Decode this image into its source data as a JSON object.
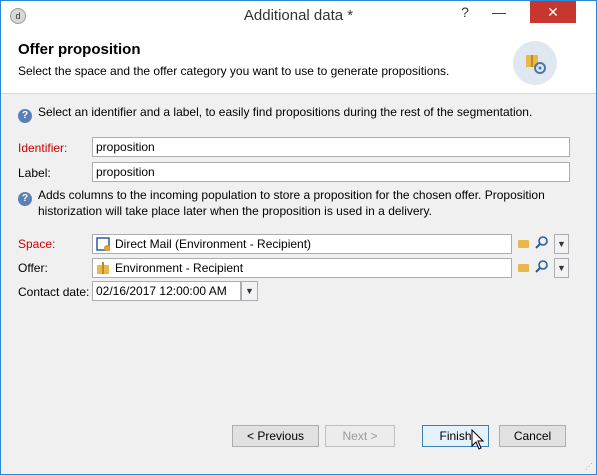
{
  "window": {
    "title": "Additional data *",
    "help_label": "?",
    "minimize_label": "—",
    "close_label": "✕"
  },
  "header": {
    "title": "Offer proposition",
    "description": "Select the space and the offer category you want to use to generate propositions."
  },
  "info1": "Select an identifier and a label, to easily find propositions during the rest of the segmentation.",
  "identifier": {
    "label": "Identifier:",
    "value": "proposition"
  },
  "label_field": {
    "label": "Label:",
    "value": "proposition"
  },
  "info2_line1": "Adds columns to the incoming population to store a proposition for the chosen offer. Proposition",
  "info2_line2": "historization will take place later when the proposition is used in a delivery.",
  "space": {
    "label": "Space:",
    "value": "Direct Mail (Environment - Recipient)"
  },
  "offer": {
    "label": "Offer:",
    "value": "Environment - Recipient"
  },
  "contact_date": {
    "label": "Contact date:",
    "value": "02/16/2017 12:00:00 AM"
  },
  "buttons": {
    "previous": "< Previous",
    "next": "Next >",
    "finish": "Finish",
    "cancel": "Cancel"
  }
}
